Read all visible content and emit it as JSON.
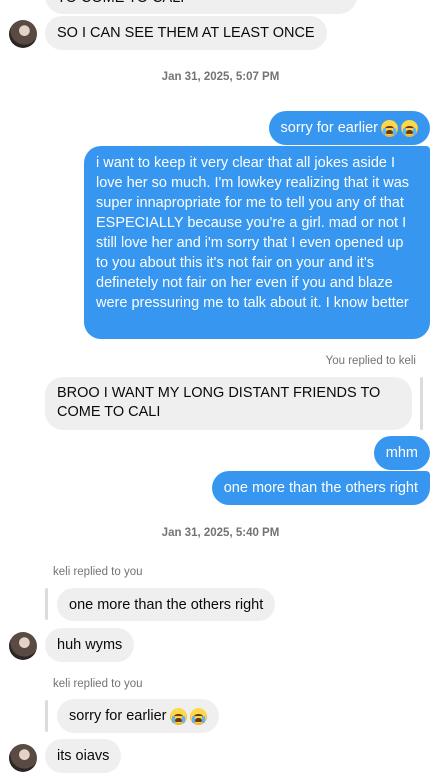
{
  "messages": {
    "cutoff_top": "TO COME TO CALI",
    "m1": "SO I CAN SEE THEM AT LEAST ONCE",
    "ts1": "Jan 31, 2025, 5:07 PM",
    "m2": "sorry for earlier",
    "m3": "i want to keep it very clear that all jokes aside I love her so much. I'm lowkey realizing that it was super innapropriate for me to tell you any of that ESPECIALLY because you're a girl. mad or not I still love her and i'm sorry that I even opened up to you about this it's not fair on your and it's definetely not fair on her even if you and blaze were pressuring me to talk about it. I know better",
    "reply_meta1": "You replied to keli",
    "quoted1": "BROO I WANT MY LONG DISTANT FRIENDS TO COME TO CALI",
    "m4": "mhm",
    "m5": "one more than the others right",
    "ts2": "Jan 31, 2025, 5:40 PM",
    "reply_meta2": "keli replied to you",
    "quoted2": "one more than the others right",
    "m6": "huh wyms",
    "reply_meta3": "keli replied to you",
    "quoted3": "sorry for earlier",
    "m7": "its oiavs"
  },
  "icons": {
    "emoji": "loudly-crying-face"
  },
  "colors": {
    "outgoing": "#3797f0",
    "incoming": "#efefef",
    "meta": "#737373"
  }
}
